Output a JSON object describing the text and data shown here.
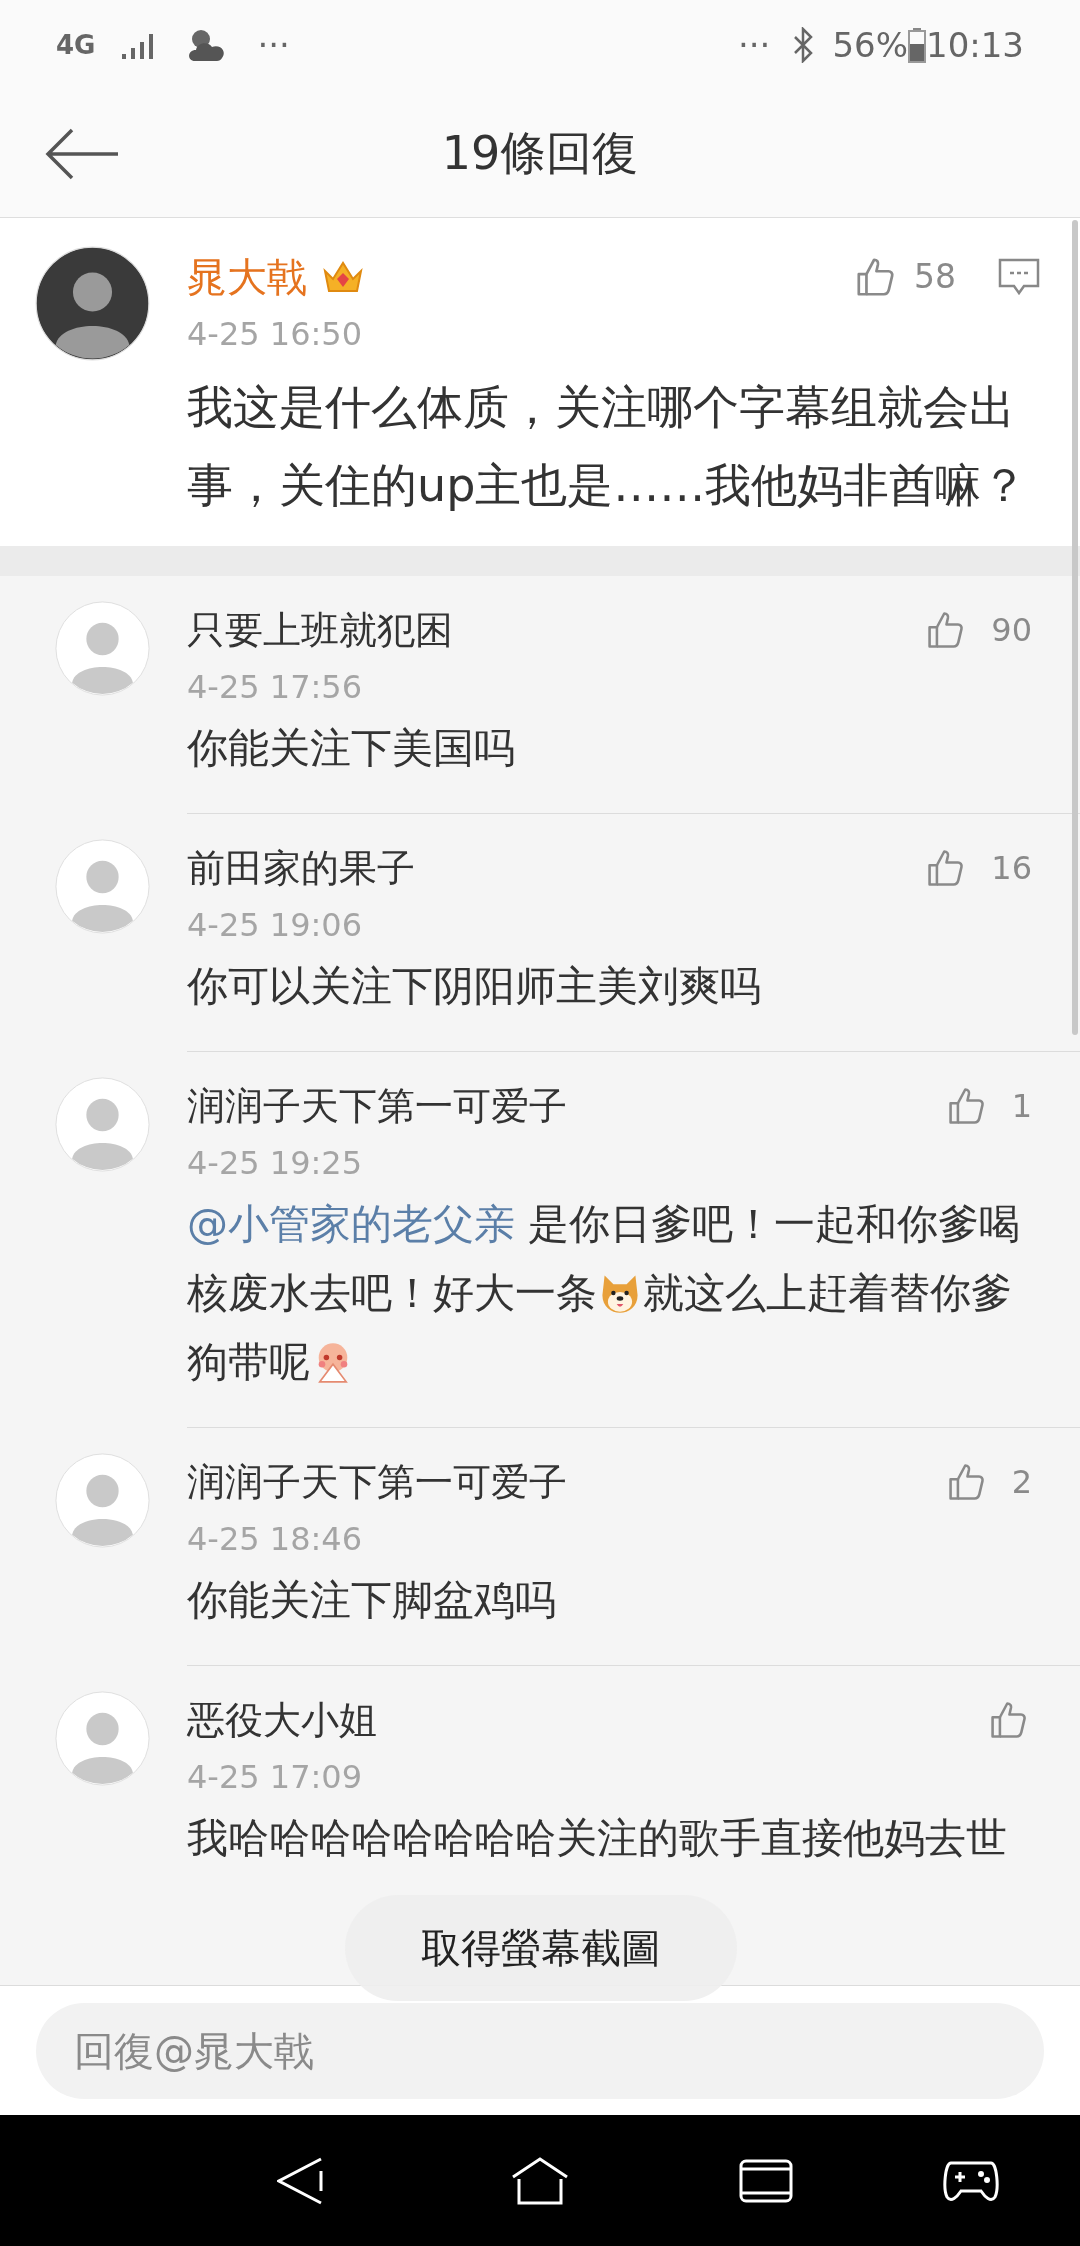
{
  "status_bar": {
    "network": "4G",
    "left_more": "···",
    "right_more": "···",
    "battery": "56%",
    "time": "10:13"
  },
  "header": {
    "title": "19條回復"
  },
  "main_comment": {
    "author": "晁大戟",
    "time": "4-25 16:50",
    "likes": "58",
    "text": "我这是什么体质，关注哪个字幕组就会出事，关住的up主也是……我他妈非酋嘛？"
  },
  "replies": [
    {
      "author": "只要上班就犯困",
      "time": "4-25 17:56",
      "likes": "90",
      "segments": [
        {
          "kind": "text",
          "text": "你能关注下美国吗"
        }
      ]
    },
    {
      "author": "前田家的果子",
      "time": "4-25 19:06",
      "likes": "16",
      "segments": [
        {
          "kind": "text",
          "text": "你可以关注下阴阳师主美刘爽吗"
        }
      ]
    },
    {
      "author": "润润子天下第一可爱子",
      "time": "4-25 19:25",
      "likes": "1",
      "segments": [
        {
          "kind": "mention",
          "text": "@小管家的老父亲"
        },
        {
          "kind": "text",
          "text": " 是你日爹吧！一起和你爹喝核废水去吧！好大一条"
        },
        {
          "kind": "dog"
        },
        {
          "kind": "text",
          "text": "就这么上赶着替你爹狗带呢"
        },
        {
          "kind": "shy"
        }
      ]
    },
    {
      "author": "润润子天下第一可爱子",
      "time": "4-25 18:46",
      "likes": "2",
      "segments": [
        {
          "kind": "text",
          "text": "你能关注下脚盆鸡吗"
        }
      ]
    },
    {
      "author": "恶役大小姐",
      "time": "4-25 17:09",
      "segments": [
        {
          "kind": "text",
          "text": "我哈哈哈哈哈哈哈哈关注的歌手直接他妈去世"
        }
      ]
    }
  ],
  "toast": "取得螢幕截圖",
  "reply_field": {
    "placeholder": "回復@晁大戟"
  }
}
